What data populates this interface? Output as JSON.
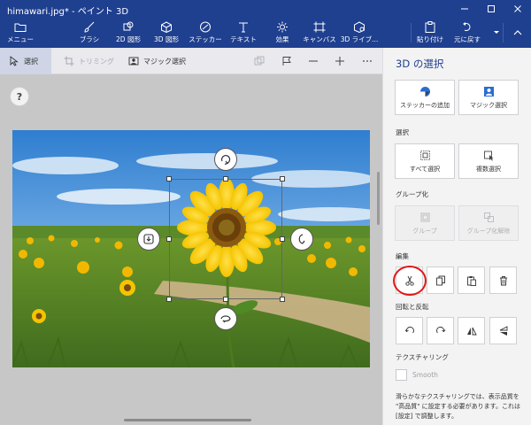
{
  "titlebar": {
    "title": "himawari.jpg* - ペイント 3D"
  },
  "ribbon": {
    "menu": "メニュー",
    "brush": "ブラシ",
    "shapes2d": "2D 図形",
    "shapes3d": "3D 図形",
    "stickers": "ステッカー",
    "text": "テキスト",
    "effects": "効果",
    "canvas": "キャンバス",
    "library3d": "3D ライブ...",
    "paste": "貼り付け",
    "undo": "元に戻す"
  },
  "toolbar": {
    "select": "選択",
    "crop": "トリミング",
    "magic_select": "マジック選択"
  },
  "workspace": {
    "help": "?"
  },
  "panel": {
    "title": "3D の選択",
    "add_sticker": "ステッカーの追加",
    "magic_select": "マジック選択",
    "section_select": "選択",
    "select_all": "すべて選択",
    "multi_select": "複数選択",
    "section_group": "グループ化",
    "group": "グループ",
    "ungroup": "グループ化解除",
    "section_edit": "編集",
    "section_rotate": "回転と反転",
    "section_texturing": "テクスチャリング",
    "smooth": "Smooth",
    "note": "滑らかなテクスチャリングでは、表示品質を \"高品質\" に設定する必要があります。これは [設定] で調整します。"
  },
  "colors": {
    "accent": "#1f3f8f",
    "annotation": "#e01818"
  }
}
